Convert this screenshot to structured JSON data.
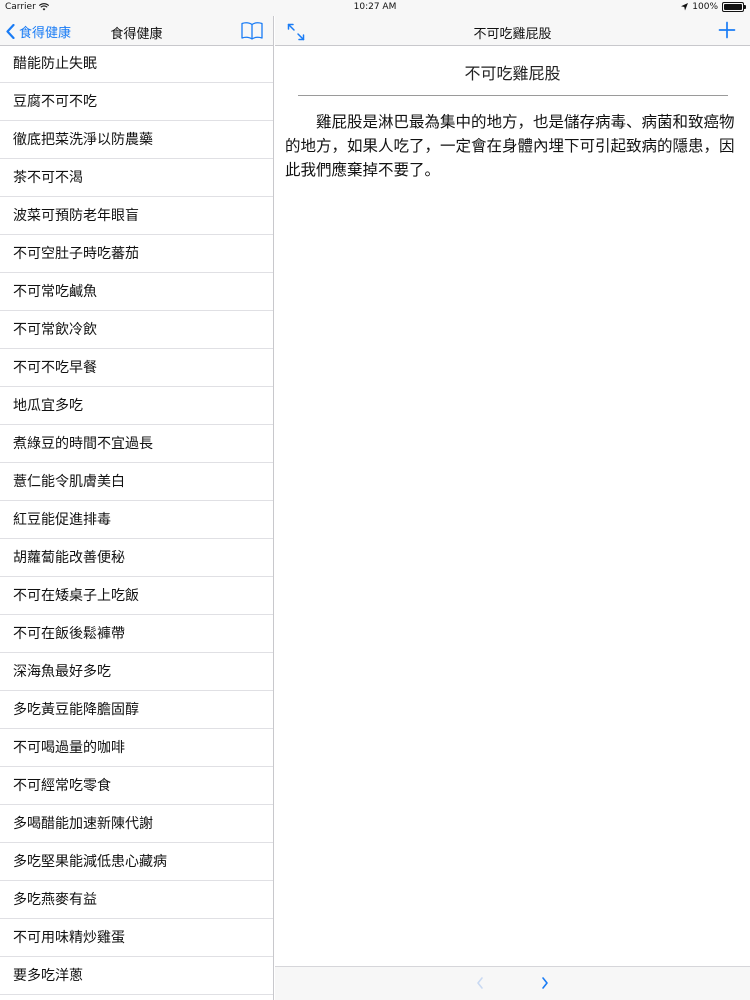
{
  "status_bar": {
    "carrier": "Carrier",
    "time": "10:27 AM",
    "battery": "100%",
    "battery_level": 1.0
  },
  "master": {
    "back_label": "食得健康",
    "title": "食得健康",
    "items": [
      {
        "label": "醋能防止失眠"
      },
      {
        "label": "豆腐不可不吃"
      },
      {
        "label": "徹底把菜洗淨以防農藥"
      },
      {
        "label": "茶不可不渴"
      },
      {
        "label": "波菜可預防老年眼盲"
      },
      {
        "label": "不可空肚子時吃蕃茄"
      },
      {
        "label": "不可常吃鹹魚"
      },
      {
        "label": "不可常飲冷飲"
      },
      {
        "label": "不可不吃早餐"
      },
      {
        "label": "地瓜宜多吃"
      },
      {
        "label": "煮綠豆的時間不宜過長"
      },
      {
        "label": "薏仁能令肌膚美白"
      },
      {
        "label": "紅豆能促進排毒"
      },
      {
        "label": "胡蘿蔔能改善便秘"
      },
      {
        "label": "不可在矮桌子上吃飯"
      },
      {
        "label": "不可在飯後鬆褲帶"
      },
      {
        "label": "深海魚最好多吃"
      },
      {
        "label": "多吃黃豆能降膽固醇"
      },
      {
        "label": "不可喝過量的咖啡"
      },
      {
        "label": "不可經常吃零食"
      },
      {
        "label": "多喝醋能加速新陳代謝"
      },
      {
        "label": "多吃堅果能減低患心藏病"
      },
      {
        "label": "多吃燕麥有益"
      },
      {
        "label": "不可用味精炒雞蛋"
      },
      {
        "label": "要多吃洋蔥"
      }
    ]
  },
  "detail": {
    "nav_title": "不可吃雞屁股",
    "article_title": "不可吃雞屁股",
    "article_body": "雞屁股是淋巴最為集中的地方，也是儲存病毒、病菌和致癌物的地方，如果人吃了，一定會在身體內埋下可引起致病的隱患，因此我們應棄掉不要了。"
  },
  "colors": {
    "accent": "#1a7cf5",
    "bar_background": "#f7f7f7",
    "separator": "#e0e0e4"
  },
  "icons": {
    "back": "chevron-left-icon",
    "book": "book-icon",
    "expand": "expand-arrows-icon",
    "add": "plus-icon",
    "prev": "chevron-left-icon",
    "next": "chevron-right-icon",
    "wifi": "wifi-icon",
    "location": "location-arrow-icon",
    "battery": "battery-icon"
  }
}
